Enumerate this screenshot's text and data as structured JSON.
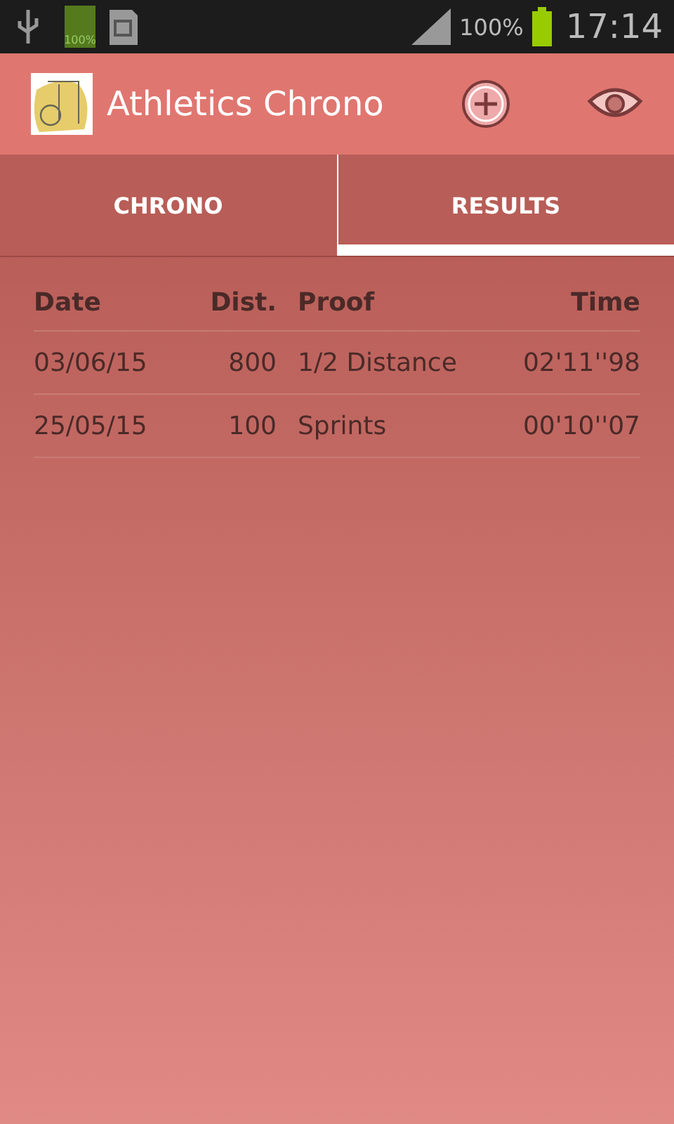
{
  "status_bar": {
    "storage_battery": "100%",
    "battery": "100%",
    "time": "17:14"
  },
  "app_bar": {
    "title": "Athletics Chrono"
  },
  "tabs": [
    {
      "label": "CHRONO",
      "selected": false
    },
    {
      "label": "RESULTS",
      "selected": true
    }
  ],
  "table": {
    "columns": [
      "Date",
      "Dist.",
      "Proof",
      "Time"
    ],
    "rows": [
      [
        "03/06/15",
        "800",
        "1/2 Distance",
        "02'11''98"
      ],
      [
        "25/05/15",
        "100",
        "Sprints",
        "00'10''07"
      ]
    ]
  }
}
